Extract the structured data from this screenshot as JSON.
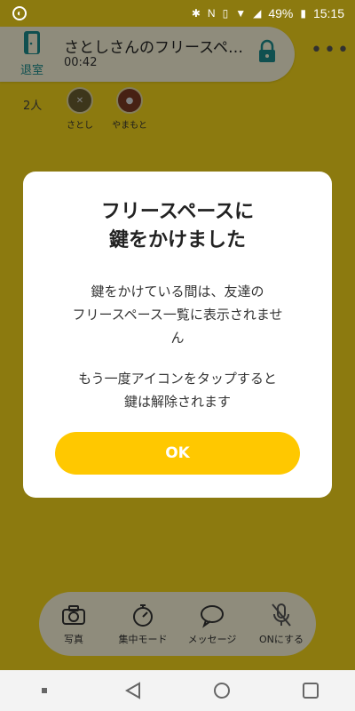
{
  "statusbar": {
    "battery": "49%",
    "time": "15:15"
  },
  "header": {
    "leave_label": "退室",
    "title": "さとしさんのフリースペ…",
    "timer": "00:42",
    "more_label": "•••"
  },
  "members": {
    "count": "2人",
    "list": [
      {
        "name": "さとし"
      },
      {
        "name": "やまもと"
      }
    ]
  },
  "dialog": {
    "title": "フリースペースに\n鍵をかけました",
    "body1": "鍵をかけている間は、友達の\nフリースペース一覧に表示されませ\nん",
    "body2": "もう一度アイコンをタップすると\n鍵は解除されます",
    "ok_label": "OK"
  },
  "toolbar": {
    "items": [
      {
        "label": "写真",
        "icon": "camera-icon"
      },
      {
        "label": "集中モード",
        "icon": "stopwatch-icon"
      },
      {
        "label": "メッセージ",
        "icon": "chat-bubble-icon"
      },
      {
        "label": "ONにする",
        "icon": "mic-off-icon"
      }
    ]
  },
  "colors": {
    "app_yellow": "#f1d21a",
    "accent_teal": "#1d8a8a",
    "button_yellow": "#ffc800"
  }
}
